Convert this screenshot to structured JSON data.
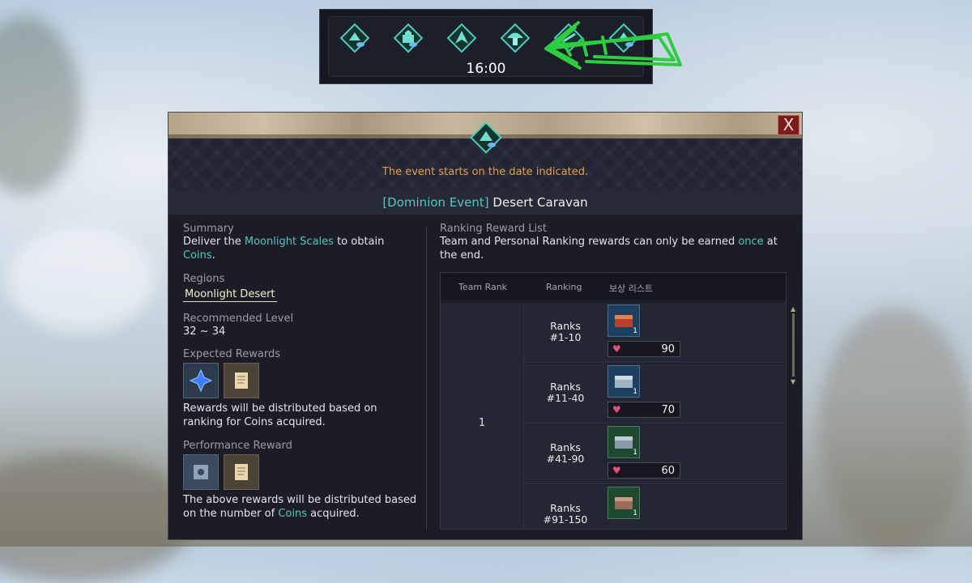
{
  "event_bar": {
    "time": "16:00",
    "icons": [
      "desert-event-icon-1",
      "castle-event-icon",
      "dragon-event-icon",
      "mushroom-event-icon",
      "arrow-event-icon"
    ]
  },
  "panel": {
    "close_label": "X",
    "notice": "The event starts on the date indicated.",
    "title_tag": "[Dominion Event]",
    "title_name": " Desert Caravan",
    "summary": {
      "label": "Summary",
      "text_before": "Deliver the ",
      "highlight_1": "Moonlight Scales",
      "text_mid": " to obtain ",
      "highlight_2": "Coins",
      "text_after": "."
    },
    "regions": {
      "label": "Regions",
      "value": "Moonlight Desert"
    },
    "level": {
      "label": "Recommended Level",
      "value": "32 ~ 34"
    },
    "expected_rewards": {
      "label": "Expected Rewards",
      "icons": [
        "blue-crystal-icon",
        "scroll-icon"
      ],
      "note": "Rewards will be distributed based on ranking for Coins acquired."
    },
    "performance_reward": {
      "label": "Performance Reward",
      "icons": [
        "book-icon",
        "scroll-icon"
      ],
      "note_before": "The above rewards will be distributed based on the number of ",
      "note_highlight": "Coins",
      "note_after": " acquired."
    },
    "ranking": {
      "label": "Ranking Reward List",
      "desc_before": "Team and Personal Ranking rewards can only be earned ",
      "desc_highlight": "once",
      "desc_after": " at the end.",
      "headers": [
        "Team Rank",
        "Ranking",
        "보상 리스트"
      ],
      "team_rank": "1",
      "rows": [
        {
          "name_1": "Ranks",
          "name_2": "#1-10",
          "qty": "1",
          "coins": "90"
        },
        {
          "name_1": "Ranks",
          "name_2": "#11-40",
          "qty": "1",
          "coins": "70"
        },
        {
          "name_1": "Ranks",
          "name_2": "#41-90",
          "qty": "1",
          "coins": "60"
        },
        {
          "name_1": "Ranks",
          "name_2": "#91-150",
          "qty": "1",
          "coins": ""
        }
      ]
    }
  },
  "colors": {
    "accent_teal": "#4ec9c0",
    "notice_orange": "#e0a050",
    "scribble_green": "#2ecc40"
  }
}
